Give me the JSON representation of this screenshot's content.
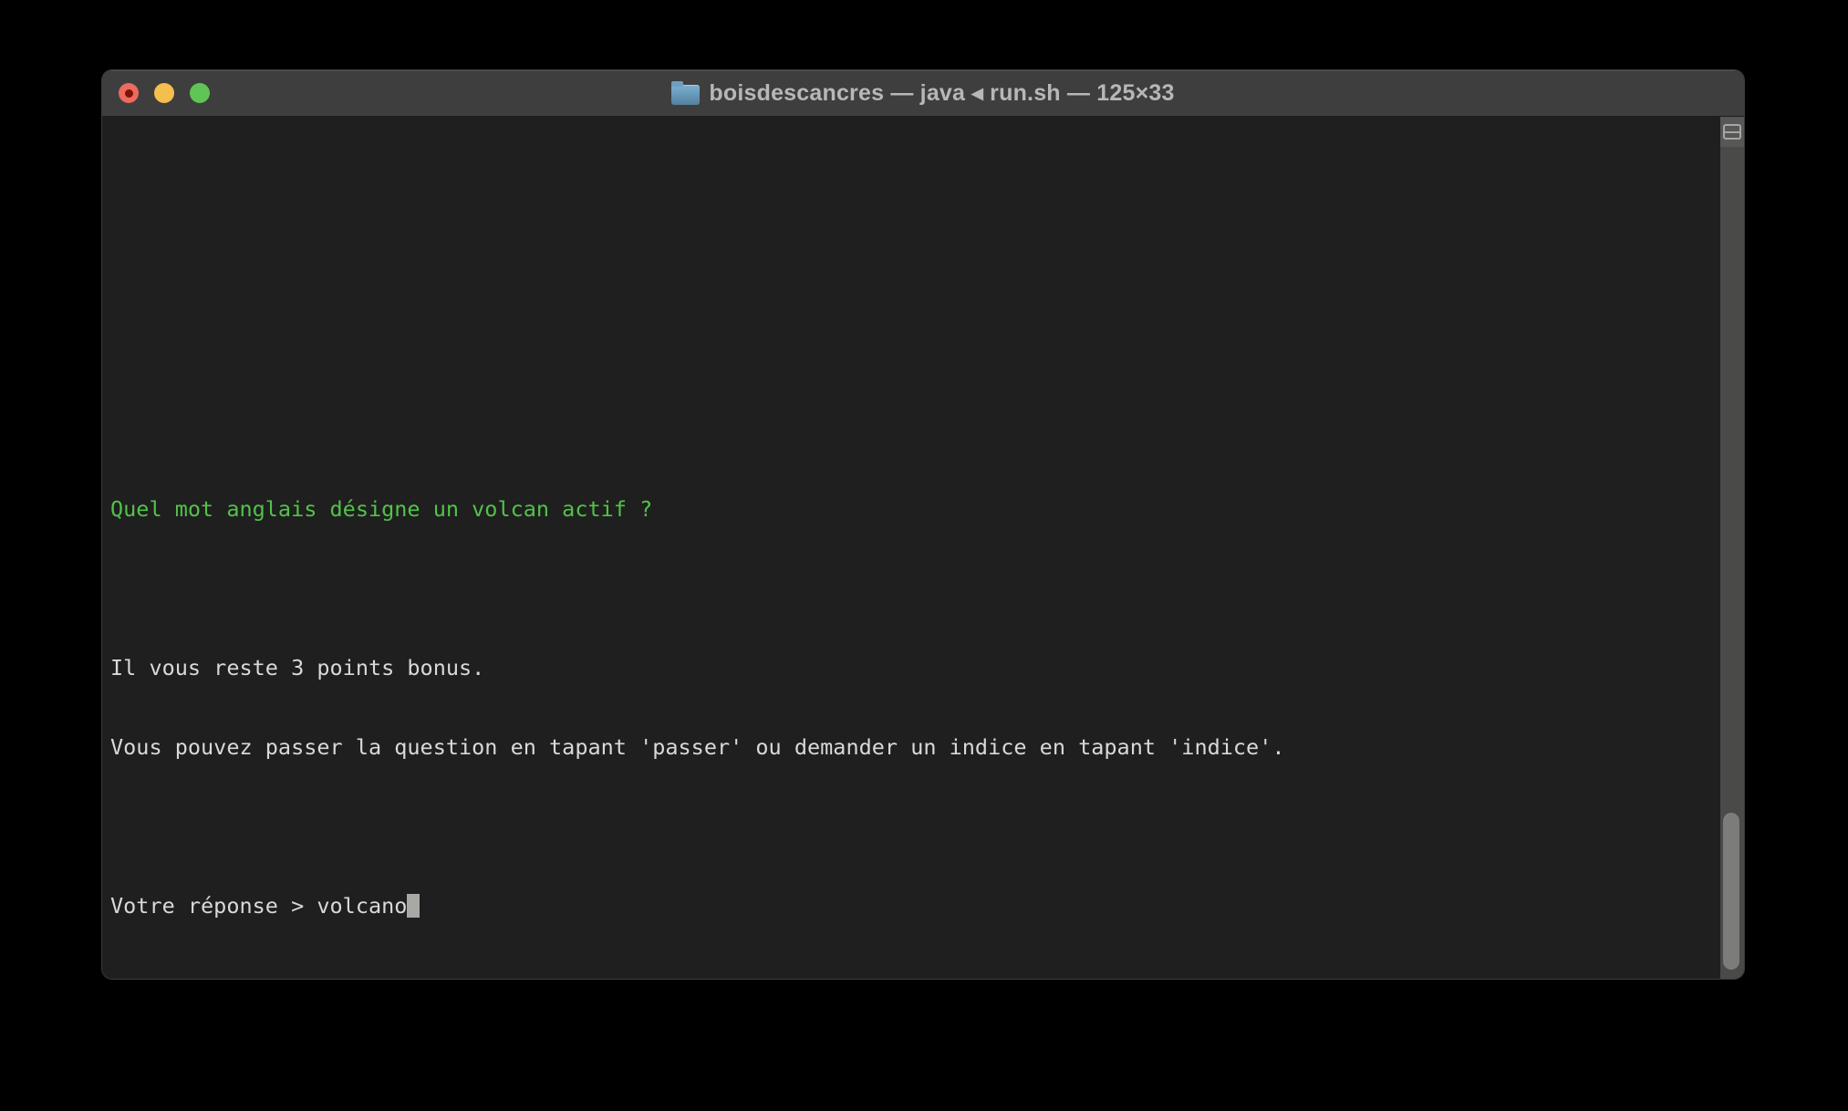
{
  "window": {
    "title": "boisdescancres — java ◂ run.sh — 125×33",
    "size_label": "125×33",
    "folder_icon": "blue-folder-icon",
    "traffic_lights": {
      "close_color": "#ec6a5e",
      "close_edited_dot_color": "#7c120a",
      "minimize_color": "#f5bf4f",
      "zoom_color": "#61c555"
    }
  },
  "terminal": {
    "lines": [
      {
        "text": "Quel mot anglais désigne un volcan actif ?",
        "color": "#52c24a"
      },
      {
        "text": ""
      },
      {
        "text": "Il vous reste 3 points bonus.",
        "color": "#d9d9d9"
      },
      {
        "text": "Vous pouvez passer la question en tapant 'passer' ou demander un indice en tapant 'indice'.",
        "color": "#d9d9d9"
      },
      {
        "text": ""
      }
    ],
    "prompt": "Votre réponse > ",
    "input_value": "volcano",
    "cursor": {
      "style": "block",
      "color": "#a8a8a5"
    }
  },
  "scrollbar": {
    "track_color": "#4a4a49",
    "thumb_color": "#7c7c7a",
    "position": "near-bottom"
  },
  "split_pane_button": {
    "icon": "split-pane-icon"
  },
  "colors": {
    "desktop_background": "#000000",
    "titlebar_background": "#3e3e3e",
    "title_text": "#b7b7b7",
    "terminal_background": "#1f1f1f",
    "terminal_text": "#d9d9d9",
    "question_green": "#52c24a"
  }
}
